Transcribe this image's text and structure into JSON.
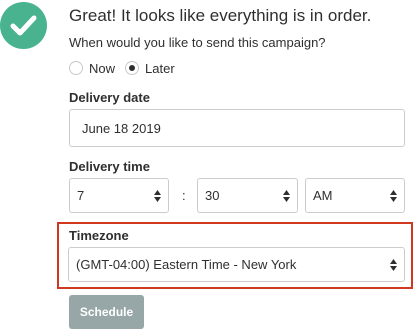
{
  "success": {
    "headline": "Great! It looks like everything is in order.",
    "question": "When would you like to send this campaign?"
  },
  "send_options": {
    "now_label": "Now",
    "later_label": "Later",
    "selected": "Later"
  },
  "delivery_date": {
    "label": "Delivery date",
    "value": "June 18 2019"
  },
  "delivery_time": {
    "label": "Delivery time",
    "hour": "7",
    "separator": ":",
    "minute": "30",
    "meridiem": "AM"
  },
  "timezone": {
    "label": "Timezone",
    "value": "(GMT-04:00) Eastern Time - New York"
  },
  "actions": {
    "schedule_label": "Schedule"
  },
  "colors": {
    "success_green": "#49b38f",
    "highlight_red": "#d0391f",
    "button_disabled": "#97a6a6"
  },
  "icons": {
    "success": "checkmark-circle-icon",
    "select": "select-arrows-icon"
  }
}
